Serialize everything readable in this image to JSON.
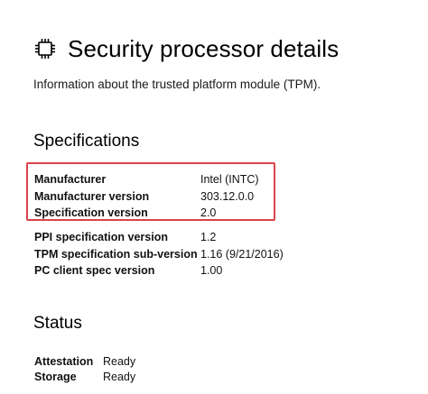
{
  "header": {
    "title": "Security processor details",
    "icon": "processor-chip-icon"
  },
  "subtitle": "Information about the trusted platform module (TPM).",
  "specifications": {
    "heading": "Specifications",
    "highlighted_rows": [
      {
        "key": "Manufacturer",
        "value": "Intel (INTC)"
      },
      {
        "key": "Manufacturer version",
        "value": "303.12.0.0"
      },
      {
        "key": "Specification version",
        "value": "2.0"
      }
    ],
    "other_rows": [
      {
        "key": "PPI specification version",
        "value": "1.2"
      },
      {
        "key": "TPM specification sub-version",
        "value": "1.16 (9/21/2016)"
      },
      {
        "key": "PC client spec version",
        "value": "1.00"
      }
    ],
    "highlight_color": "#d9434a"
  },
  "status": {
    "heading": "Status",
    "rows": [
      {
        "key": "Attestation",
        "value": "Ready"
      },
      {
        "key": "Storage",
        "value": "Ready"
      }
    ]
  }
}
